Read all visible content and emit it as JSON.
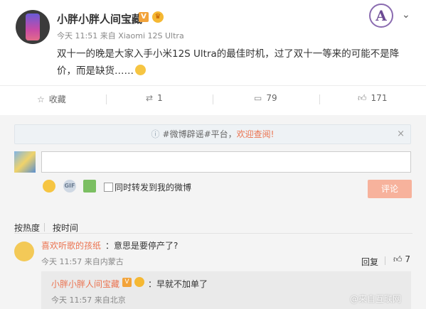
{
  "post": {
    "author": "小胖小胖人间宝藏",
    "v_badge": "V",
    "crown": "♛",
    "meta": "今天 11:51 来自 Xiaomi 12S Ultra",
    "text": "双十一的晚是大家入手小米12S Ultra的最佳时机，过了双十一等来的可能不是降价，而是缺货……",
    "corner_logo": "A",
    "menu_icon": "chevron-down-icon"
  },
  "actions": {
    "favorite_label": "收藏",
    "repost_count": "1",
    "comment_count": "79",
    "like_count": "171"
  },
  "notice": {
    "text": "#微博辟谣#平台，",
    "highlight": "欢迎查阅!",
    "close": "×"
  },
  "composer": {
    "input_value": "",
    "gif_label": "GIF",
    "repost_label": "同时转发到我的微博",
    "submit_label": "评论"
  },
  "sort": {
    "by_hot": "按热度",
    "by_time": "按时间"
  },
  "comments": [
    {
      "author": "喜欢听歌的孩纸",
      "text": "：意思是要停产了?",
      "meta": "今天 11:57 来自内蒙古",
      "reply_label": "回复",
      "likes": "7",
      "replies": [
        {
          "author": "小胖小胖人间宝藏",
          "text": "：早就不加单了",
          "meta": "今天 11:57 来自北京"
        }
      ]
    }
  ],
  "watermark": "@来自互联网",
  "colors": {
    "accent": "#eb7350",
    "submit_bg": "#f7b29c",
    "vip_badge": "#f2a33a"
  }
}
